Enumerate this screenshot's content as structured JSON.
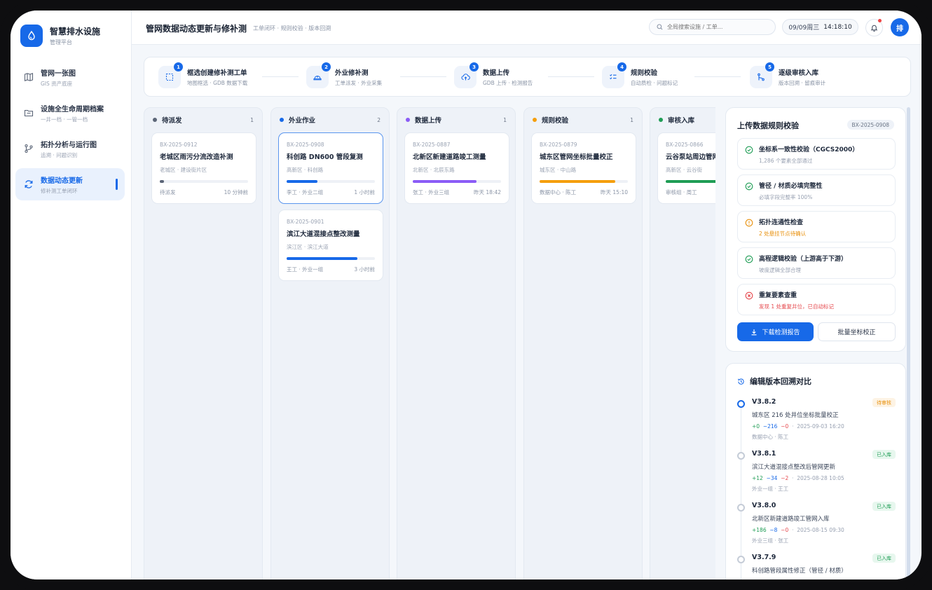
{
  "brand": {
    "name": "智慧排水设施",
    "sub": "管理平台"
  },
  "nav": [
    {
      "title": "管网一张图",
      "sub": "GIS 资产底座"
    },
    {
      "title": "设施全生命周期档案",
      "sub": "一井一档 · 一管一档"
    },
    {
      "title": "拓扑分析与运行图",
      "sub": "追溯 · 问题识别"
    },
    {
      "title": "数据动态更新",
      "sub": "修补测工单闭环"
    }
  ],
  "header": {
    "title": "管网数据动态更新与修补测",
    "sub": "工单闭环 · 规则校验 · 版本回溯",
    "search_placeholder": "全局搜索设施 / 工单...",
    "date": "09/09周三",
    "time": "14:18:10",
    "avatar": "排"
  },
  "steps": [
    {
      "num": "1",
      "title": "框选创建修补测工单",
      "sub": "地图框选 · GDB 数据下载"
    },
    {
      "num": "2",
      "title": "外业修补测",
      "sub": "工单派发 · 外业采集"
    },
    {
      "num": "3",
      "title": "数据上传",
      "sub": "GDB 上传 · 检测报告"
    },
    {
      "num": "4",
      "title": "规则校验",
      "sub": "自动质检 · 问题标记"
    },
    {
      "num": "5",
      "title": "逐级审核入库",
      "sub": "版本回溯 · 留痕审计"
    }
  ],
  "columns": [
    {
      "title": "待派发",
      "count": "1",
      "color": "#5b6577",
      "cards": [
        {
          "id": "BX-2025-0912",
          "title": "老城区雨污分流改造补测",
          "loc": "老城区 · 建设街片区",
          "progress": 0.05,
          "bar": "#5b6577",
          "who": "待派发",
          "time": "10 分钟前"
        }
      ]
    },
    {
      "title": "外业作业",
      "count": "2",
      "color": "#1769e8",
      "cards": [
        {
          "id": "BX-2025-0908",
          "title": "科创路 DN600 管段复测",
          "loc": "高新区 · 科创路",
          "progress": 0.35,
          "bar": "#1769e8",
          "who": "李工 · 外业二组",
          "time": "1 小时前"
        },
        {
          "id": "BX-2025-0901",
          "title": "滨江大道混接点整改测量",
          "loc": "滨江区 · 滨江大道",
          "progress": 0.8,
          "bar": "#1769e8",
          "who": "王工 · 外业一组",
          "time": "3 小时前"
        }
      ]
    },
    {
      "title": "数据上传",
      "count": "1",
      "color": "#8b5cf6",
      "cards": [
        {
          "id": "BX-2025-0887",
          "title": "北新区新建道路竣工测量",
          "loc": "北新区 · 北辰东路",
          "progress": 0.72,
          "bar": "#8b5cf6",
          "who": "张工 · 外业三组",
          "time": "昨天 18:42"
        }
      ]
    },
    {
      "title": "规则校验",
      "count": "1",
      "color": "#f59e0b",
      "cards": [
        {
          "id": "BX-2025-0879",
          "title": "城东区管网坐标批量校正",
          "loc": "城东区 · 中山路",
          "progress": 0.86,
          "bar": "#f59e0b",
          "who": "数据中心 · 陈工",
          "time": "昨天 15:10"
        }
      ]
    },
    {
      "title": "审核入库",
      "count": "",
      "color": "#1f9d55",
      "cards": [
        {
          "id": "BX-2025-0866",
          "title": "云谷泵站周边管网",
          "loc": "高新区 · 云谷街",
          "progress": 0.95,
          "bar": "#1f9d55",
          "who": "审核组 · 周工",
          "time": ""
        }
      ]
    }
  ],
  "validation": {
    "title": "上传数据规则校验",
    "badge": "BX-2025-0908",
    "checks": [
      {
        "title": "坐标系一致性校验（CGCS2000）",
        "sub": "1,286 个要素全部通过",
        "status": "ok"
      },
      {
        "title": "管径 / 材质必填完整性",
        "sub": "必填字段完整率 100%",
        "status": "ok"
      },
      {
        "title": "拓扑连通性检查",
        "sub": "2 处悬挂节点待确认",
        "status": "warn"
      },
      {
        "title": "高程逻辑校验（上游高于下游）",
        "sub": "坡度逻辑全部合理",
        "status": "ok"
      },
      {
        "title": "重复要素查重",
        "sub": "发现 1 处重复井位，已自动标记",
        "status": "err"
      }
    ],
    "btn_download": "下载检测报告",
    "btn_batch": "批量坐标校正"
  },
  "versions": {
    "title": "编辑版本回溯对比",
    "items": [
      {
        "name": "V3.8.2",
        "tag": "待审核",
        "tag_type": "pending",
        "desc": "城东区 216 处井位坐标批量校正",
        "add": "+0",
        "mod": "~216",
        "del": "−0",
        "date": "2025-09-03 16:20",
        "who": "数据中心 · 陈工",
        "current": true
      },
      {
        "name": "V3.8.1",
        "tag": "已入库",
        "tag_type": "done",
        "desc": "滨江大道混接点整改后管网更新",
        "add": "+12",
        "mod": "~34",
        "del": "−2",
        "date": "2025-08-28 10:05",
        "who": "外业一组 · 王工",
        "current": false
      },
      {
        "name": "V3.8.0",
        "tag": "已入库",
        "tag_type": "done",
        "desc": "北新区新建道路竣工管网入库",
        "add": "+186",
        "mod": "~8",
        "del": "−0",
        "date": "2025-08-15 09:30",
        "who": "外业三组 · 张工",
        "current": false
      },
      {
        "name": "V3.7.9",
        "tag": "已入库",
        "tag_type": "done",
        "desc": "科创路管段属性修正（管径 / 材质）",
        "add": "",
        "mod": "",
        "del": "",
        "date": "",
        "who": "",
        "current": false
      }
    ]
  },
  "colors": {
    "accent": "#1769e8",
    "ok": "#1f9d55",
    "warn": "#e8900c",
    "err": "#e5484d"
  }
}
